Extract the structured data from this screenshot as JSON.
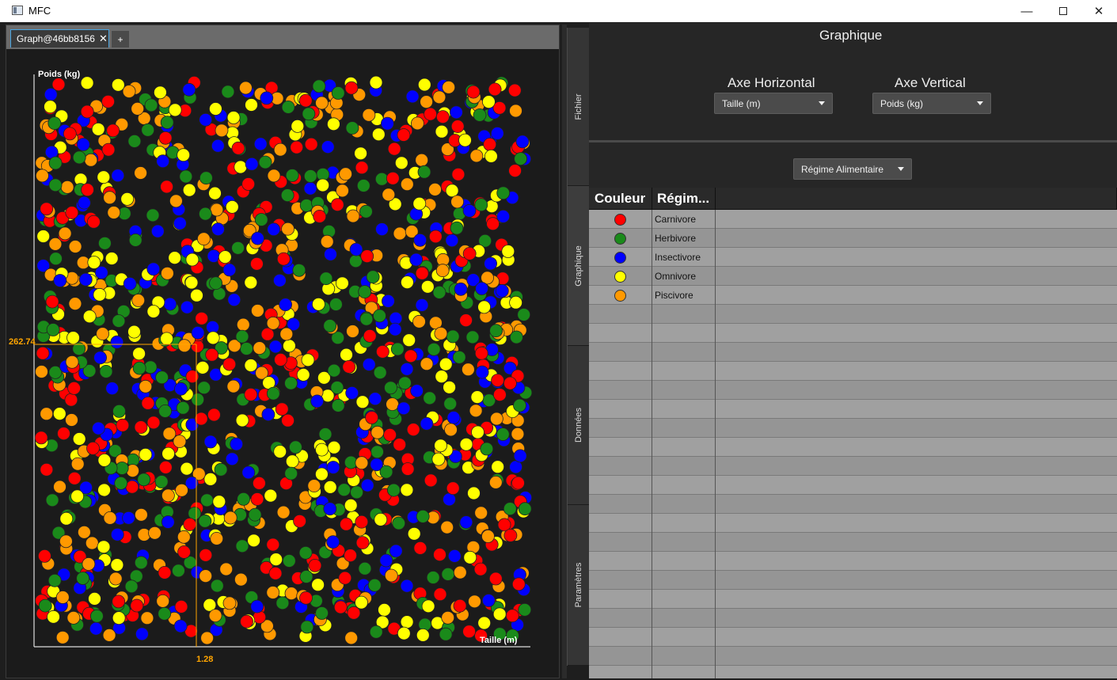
{
  "window": {
    "title": "MFC"
  },
  "tabs": [
    {
      "label": "Graph@46bb8156"
    }
  ],
  "tab_add_label": "+",
  "sidebar": [
    {
      "label": "Fichier"
    },
    {
      "label": "Graphique"
    },
    {
      "label": "Données"
    },
    {
      "label": "Paramètres"
    }
  ],
  "graph_panel": {
    "title": "Graphique",
    "horizontal_axis_label": "Axe Horizontal",
    "horizontal_axis_value": "Taille (m)",
    "vertical_axis_label": "Axe Vertical",
    "vertical_axis_value": "Poids (kg)",
    "group_by_value": "Régime Alimentaire"
  },
  "legend_table": {
    "columns": [
      "Couleur",
      "Régim..."
    ],
    "rows": [
      {
        "name": "Carnivore",
        "color": "#ff0000"
      },
      {
        "name": "Herbivore",
        "color": "#1a8a1a"
      },
      {
        "name": "Insectivore",
        "color": "#0000ff"
      },
      {
        "name": "Omnivore",
        "color": "#ffff00"
      },
      {
        "name": "Piscivore",
        "color": "#ff9900"
      }
    ]
  },
  "chart_data": {
    "type": "scatter",
    "xlabel": "Taille (m)",
    "ylabel": "Poids (kg)",
    "crosshair": {
      "x_label": "1.28",
      "y_label": "262.74"
    },
    "point_count_estimate": 1300,
    "series": [
      {
        "name": "Carnivore",
        "color": "#ff0000"
      },
      {
        "name": "Herbivore",
        "color": "#1a8a1a"
      },
      {
        "name": "Insectivore",
        "color": "#0000ff"
      },
      {
        "name": "Omnivore",
        "color": "#ffff00"
      },
      {
        "name": "Piscivore",
        "color": "#ff9900"
      }
    ],
    "grid": false,
    "legend": "none"
  }
}
